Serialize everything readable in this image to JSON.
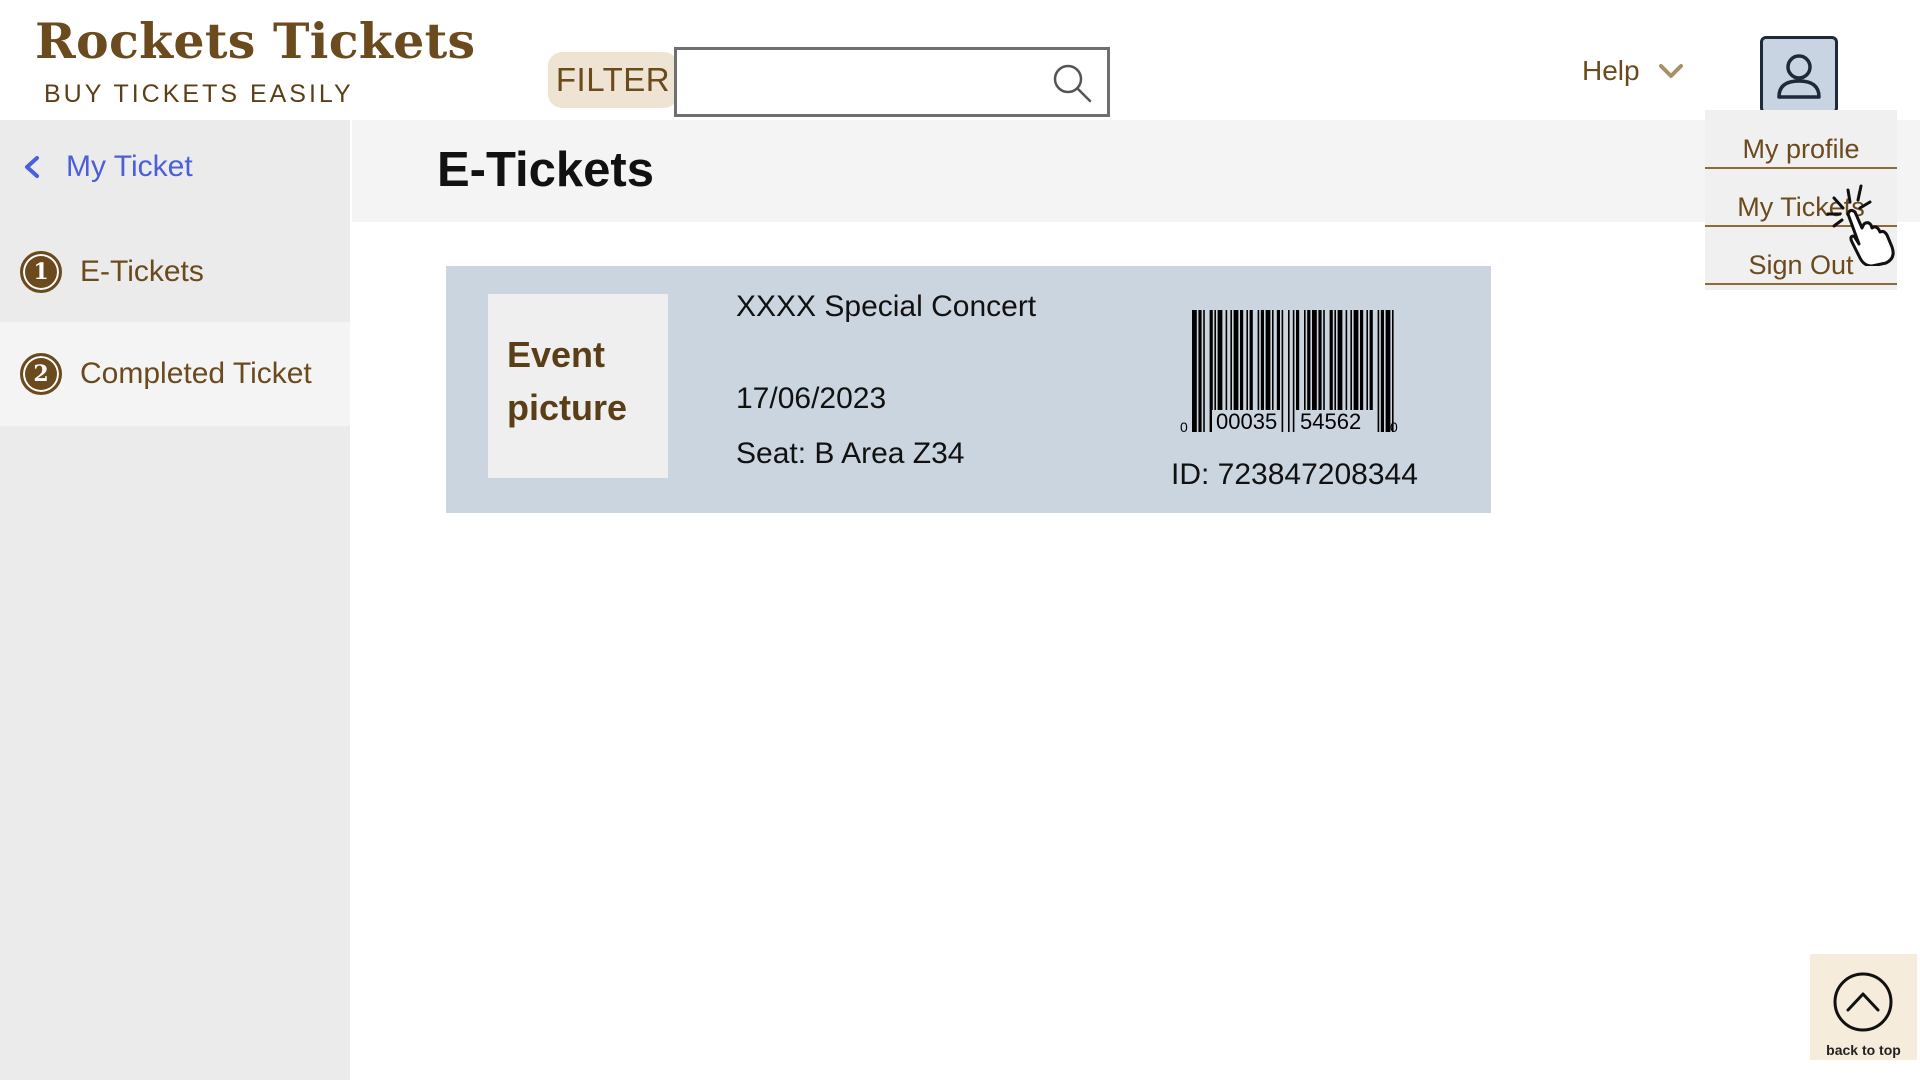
{
  "brand": {
    "title": "Rockets Tickets",
    "subtitle": "BUY TICKETS EASILY"
  },
  "header": {
    "filter_label": "FILTER",
    "search_value": "",
    "search_icon": "search-icon",
    "help_label": "Help",
    "help_icon": "chevron-down-icon",
    "avatar_icon": "user-icon"
  },
  "account_menu": {
    "items": [
      {
        "label": "My profile"
      },
      {
        "label": "My Tickets"
      },
      {
        "label": "Sign Out"
      }
    ]
  },
  "sidebar": {
    "back_label": "My Ticket",
    "items": [
      {
        "number": "1",
        "label": "E-Tickets",
        "active": false
      },
      {
        "number": "2",
        "label": "Completed Ticket",
        "active": true
      }
    ]
  },
  "main": {
    "title": "E-Tickets",
    "ticket": {
      "image_label": "Event picture",
      "event_name": "XXXX Special Concert",
      "date": "17/06/2023",
      "seat": "Seat: B Area Z34",
      "barcode_left_digit": "0",
      "barcode_group1": "00035",
      "barcode_group2": "54562",
      "barcode_right_digit": "0",
      "id": "ID: 723847208344"
    }
  },
  "back_to_top": {
    "label": "back to top",
    "icon": "arrow-up-circle-icon"
  },
  "colors": {
    "brand_brown": "#6b4a1e",
    "accent_blue": "#4a5fd9",
    "ticket_bg": "#cbd5e0",
    "sidebar_bg": "#ebebeb"
  }
}
